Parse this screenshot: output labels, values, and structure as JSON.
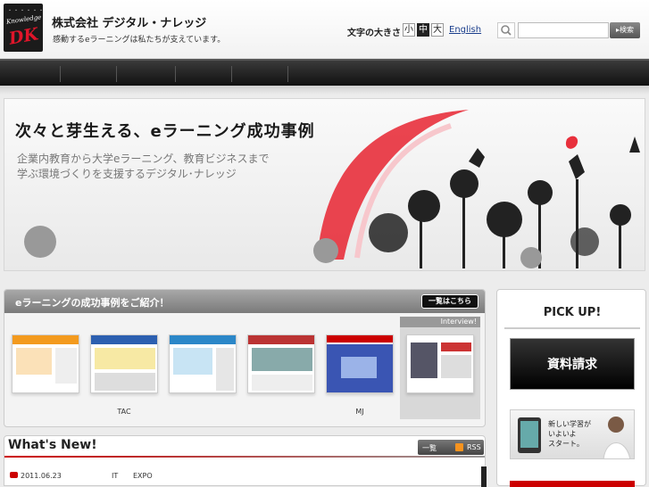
{
  "header": {
    "logo_top": "・・・・・・・",
    "logo_word": "Knowledge",
    "logo_mark": "DK",
    "company": "株式会社 デジタル・ナレッジ",
    "tagline": "感動するeラーニングは私たちが支えています。",
    "fontsize_label": "文字の大きさ",
    "fontsize_small": "小",
    "fontsize_medium": "中",
    "fontsize_large": "大",
    "english": "English",
    "search_placeholder": "",
    "search_button": "▸検索"
  },
  "hero": {
    "title": "次々と芽生える、eラーニング成功事例",
    "sub1": "企業内教育から大学eラーニング、教育ビジネスまで",
    "sub2": "学ぶ環境づくりを支援するデジタル･ナレッジ"
  },
  "cases": {
    "title": "eラーニングの成功事例をご紹介！",
    "list_button": "一覧はこちら",
    "interview_tag": "Interview!",
    "items": [
      {
        "label": ""
      },
      {
        "label": "TAC"
      },
      {
        "label": ""
      },
      {
        "label": ""
      },
      {
        "label": "MJ"
      },
      {
        "label": ""
      }
    ]
  },
  "pickup": {
    "title": "PICK UP!",
    "banner1": "資料請求",
    "banner2_line1": "新しい学習が",
    "banner2_line2": "いよいよ",
    "banner2_line3": "スタート。"
  },
  "news": {
    "title": "What's New!",
    "list_link": "一覧",
    "rss_link": "RSS",
    "rows": [
      {
        "date": "2011.06.23",
        "cat1": "IT",
        "cat2": "EXPO"
      }
    ]
  },
  "colors": {
    "accent": "#cc0000",
    "nav": "#1a1a1a",
    "link": "#1a3e8c"
  }
}
